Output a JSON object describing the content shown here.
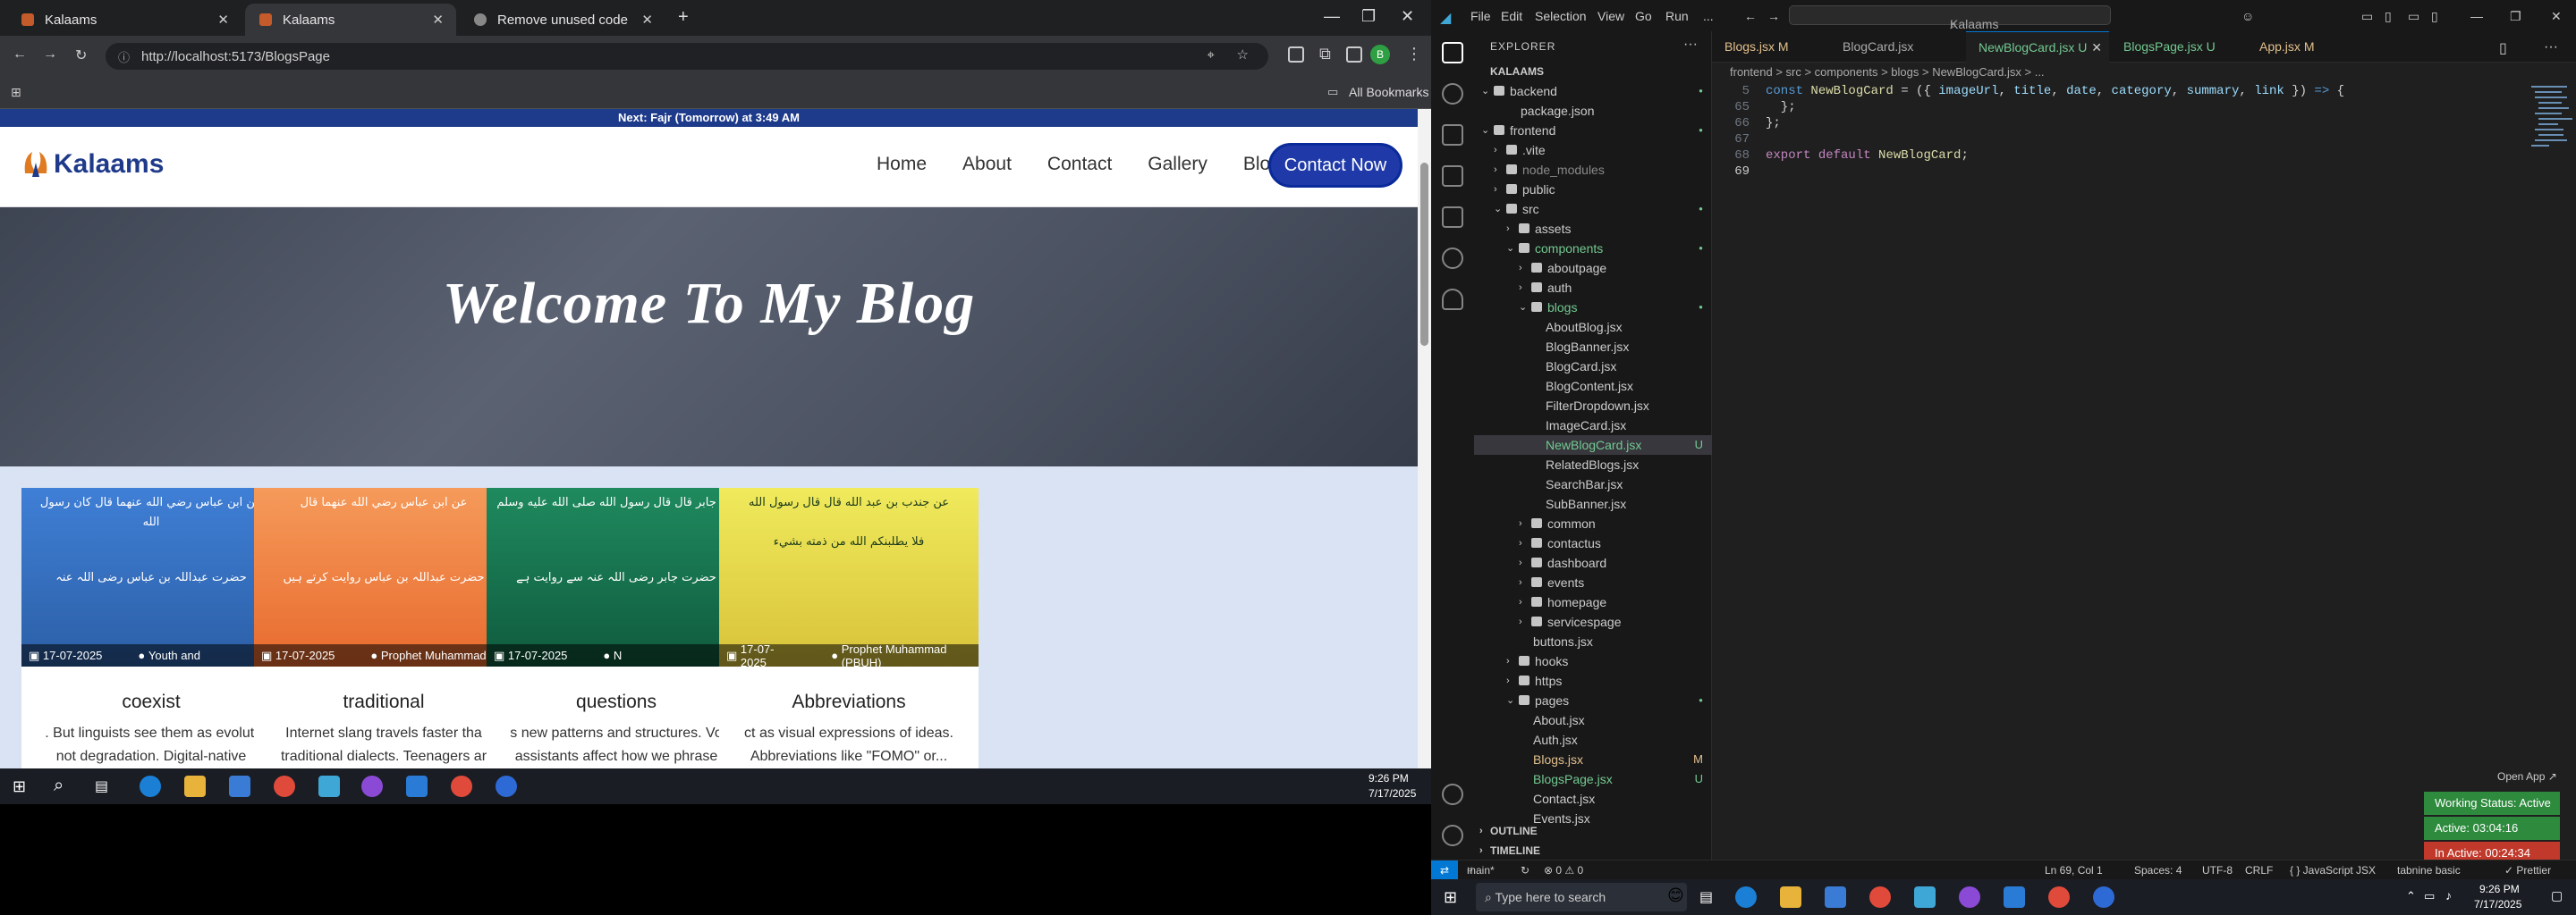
{
  "browser": {
    "tabs": [
      {
        "title": "Kalaams",
        "active": false
      },
      {
        "title": "Kalaams",
        "active": true
      },
      {
        "title": "Remove unused code",
        "active": false
      }
    ],
    "new_tab": "+",
    "url": "http://localhost:5173/BlogsPage",
    "bookmarks_label": "All Bookmarks",
    "profile_initial": "B"
  },
  "site": {
    "prayer_bar": "Next: Fajr (Tomorrow) at 3:49 AM",
    "logo": "Kalaams",
    "nav": [
      "Home",
      "About",
      "Contact",
      "Gallery",
      "Blogs"
    ],
    "cta": "Contact Now",
    "hero_title": "Welcome To My Blog",
    "cards": [
      {
        "date": "17-07-2025",
        "author": "Youth and",
        "title": "coexist",
        "summary": ". But linguists see them as evoluti",
        "summary2": "not degradation. Digital-native",
        "arabic": "عن ابن عباس رضي الله عنهما قال كان رسول الله",
        "urdu": "حضرت عبداللہ بن عباس رضی اللہ عنہ",
        "color": "#4a90d9"
      },
      {
        "date": "17-07-2025",
        "author": "Prophet Muhammad (F",
        "title": "traditional",
        "summary": "Internet slang travels faster tha",
        "summary2": "traditional dialects. Teenagers ar",
        "arabic": "عن ابن عباس رضي الله عنهما قال",
        "urdu": "حضرت عبداللہ بن عباس روایت کرتے ہیں",
        "color": "#f08a4b"
      },
      {
        "date": "17-07-2025",
        "author": "N",
        "title": "questions",
        "summary": "s new patterns and structures. Vo",
        "summary2": "assistants affect how we phrase",
        "arabic": "عن جابر قال قال رسول الله صلى الله عليه وسلم",
        "urdu": "حضرت جابر رضی اللہ عنہ سے روایت ہے",
        "color": "#1f7a57"
      },
      {
        "date": "17-07-2025",
        "author": "Prophet Muhammad (PBUH)",
        "title": "Abbreviations",
        "summary": "ct as visual expressions of ideas.",
        "summary2": "Abbreviations like \"FOMO\" or...",
        "arabic": "عن جندب بن عبد الله قال قال رسول الله",
        "urdu": "فلا يطلبنكم الله من ذمته بشيء",
        "color": "#e4e25a"
      }
    ]
  },
  "taskbar_left": {
    "time": "9:26 PM",
    "date": "7/17/2025"
  },
  "vscode": {
    "menu": [
      "File",
      "Edit",
      "Selection",
      "View",
      "Go",
      "Run",
      "..."
    ],
    "search": "Kalaams",
    "explorer_title": "EXPLORER",
    "workspace": "KALAAMS",
    "tree": [
      {
        "name": "backend",
        "type": "folder",
        "indent": 1,
        "open": true,
        "status": "dot"
      },
      {
        "name": "package.json",
        "type": "file",
        "indent": 3,
        "status": ""
      },
      {
        "name": "frontend",
        "type": "folder",
        "indent": 1,
        "open": true,
        "status": "dot"
      },
      {
        "name": ".vite",
        "type": "folder",
        "indent": 2,
        "open": false,
        "status": ""
      },
      {
        "name": "node_modules",
        "type": "folder",
        "indent": 2,
        "open": false,
        "status": "",
        "dim": true
      },
      {
        "name": "public",
        "type": "folder",
        "indent": 2,
        "open": false,
        "status": ""
      },
      {
        "name": "src",
        "type": "folder",
        "indent": 2,
        "open": true,
        "status": "dot"
      },
      {
        "name": "assets",
        "type": "folder",
        "indent": 3,
        "open": false,
        "status": ""
      },
      {
        "name": "components",
        "type": "folder",
        "indent": 3,
        "open": true,
        "status": "dot",
        "green": true
      },
      {
        "name": "aboutpage",
        "type": "folder",
        "indent": 4,
        "open": false,
        "status": ""
      },
      {
        "name": "auth",
        "type": "folder",
        "indent": 4,
        "open": false,
        "status": ""
      },
      {
        "name": "blogs",
        "type": "folder",
        "indent": 4,
        "open": true,
        "status": "dot",
        "green": true
      },
      {
        "name": "AboutBlog.jsx",
        "type": "file",
        "indent": 5,
        "status": ""
      },
      {
        "name": "BlogBanner.jsx",
        "type": "file",
        "indent": 5,
        "status": ""
      },
      {
        "name": "BlogCard.jsx",
        "type": "file",
        "indent": 5,
        "status": ""
      },
      {
        "name": "BlogContent.jsx",
        "type": "file",
        "indent": 5,
        "status": ""
      },
      {
        "name": "FilterDropdown.jsx",
        "type": "file",
        "indent": 5,
        "status": ""
      },
      {
        "name": "ImageCard.jsx",
        "type": "file",
        "indent": 5,
        "status": ""
      },
      {
        "name": "NewBlogCard.jsx",
        "type": "file",
        "indent": 5,
        "status": "U",
        "selected": true,
        "green": true
      },
      {
        "name": "RelatedBlogs.jsx",
        "type": "file",
        "indent": 5,
        "status": ""
      },
      {
        "name": "SearchBar.jsx",
        "type": "file",
        "indent": 5,
        "status": ""
      },
      {
        "name": "SubBanner.jsx",
        "type": "file",
        "indent": 5,
        "status": ""
      },
      {
        "name": "common",
        "type": "folder",
        "indent": 4,
        "open": false,
        "status": ""
      },
      {
        "name": "contactus",
        "type": "folder",
        "indent": 4,
        "open": false,
        "status": ""
      },
      {
        "name": "dashboard",
        "type": "folder",
        "indent": 4,
        "open": false,
        "status": ""
      },
      {
        "name": "events",
        "type": "folder",
        "indent": 4,
        "open": false,
        "status": ""
      },
      {
        "name": "homepage",
        "type": "folder",
        "indent": 4,
        "open": false,
        "status": ""
      },
      {
        "name": "servicespage",
        "type": "folder",
        "indent": 4,
        "open": false,
        "status": ""
      },
      {
        "name": "buttons.jsx",
        "type": "file",
        "indent": 4,
        "status": ""
      },
      {
        "name": "hooks",
        "type": "folder",
        "indent": 3,
        "open": false,
        "status": ""
      },
      {
        "name": "https",
        "type": "folder",
        "indent": 3,
        "open": false,
        "status": ""
      },
      {
        "name": "pages",
        "type": "folder",
        "indent": 3,
        "open": true,
        "status": "dot"
      },
      {
        "name": "About.jsx",
        "type": "file",
        "indent": 4,
        "status": ""
      },
      {
        "name": "Auth.jsx",
        "type": "file",
        "indent": 4,
        "status": ""
      },
      {
        "name": "Blogs.jsx",
        "type": "file",
        "indent": 4,
        "status": "M",
        "orange": true
      },
      {
        "name": "BlogsPage.jsx",
        "type": "file",
        "indent": 4,
        "status": "U",
        "green": true
      },
      {
        "name": "Contact.jsx",
        "type": "file",
        "indent": 4,
        "status": ""
      },
      {
        "name": "Events.jsx",
        "type": "file",
        "indent": 4,
        "status": ""
      }
    ],
    "outline": "OUTLINE",
    "timeline": "TIMELINE",
    "editor_tabs": [
      {
        "name": "Blogs.jsx",
        "status": "M",
        "active": false
      },
      {
        "name": "BlogCard.jsx",
        "status": "",
        "active": false
      },
      {
        "name": "NewBlogCard.jsx",
        "status": "U",
        "active": true
      },
      {
        "name": "BlogsPage.jsx",
        "status": "U",
        "active": false
      },
      {
        "name": "App.jsx",
        "status": "M",
        "active": false
      }
    ],
    "breadcrumb": "frontend > src > components > blogs > NewBlogCard.jsx > ...",
    "code_lines": [
      {
        "n": "5",
        "text": "const NewBlogCard = ({ imageUrl, title, date, category, summary, link }) => {"
      },
      {
        "n": "65",
        "text": "  };"
      },
      {
        "n": "66",
        "text": "};"
      },
      {
        "n": "67",
        "text": ""
      },
      {
        "n": "68",
        "text": "export default NewBlogCard;"
      },
      {
        "n": "69",
        "text": ""
      }
    ],
    "status": {
      "branch": "main*",
      "problems": "⊗ 0 ⚠ 0",
      "position": "Ln 69, Col 1",
      "spaces": "Spaces: 4",
      "encoding": "UTF-8",
      "eol": "CRLF",
      "language": "{ } JavaScript JSX",
      "tabnine": "tabnine basic",
      "prettier": "✓ Prettier"
    },
    "open_app": "Open App ↗",
    "badges": [
      {
        "text": "Working Status: Active",
        "color": "#2e8b3e"
      },
      {
        "text": "Active: 03:04:16",
        "color": "#2e8b3e"
      },
      {
        "text": "In Active: 00:24:34",
        "color": "#c0392b"
      }
    ]
  },
  "taskbar_right": {
    "search_placeholder": "Type here to search",
    "time": "9:26 PM",
    "date": "7/17/2025"
  }
}
